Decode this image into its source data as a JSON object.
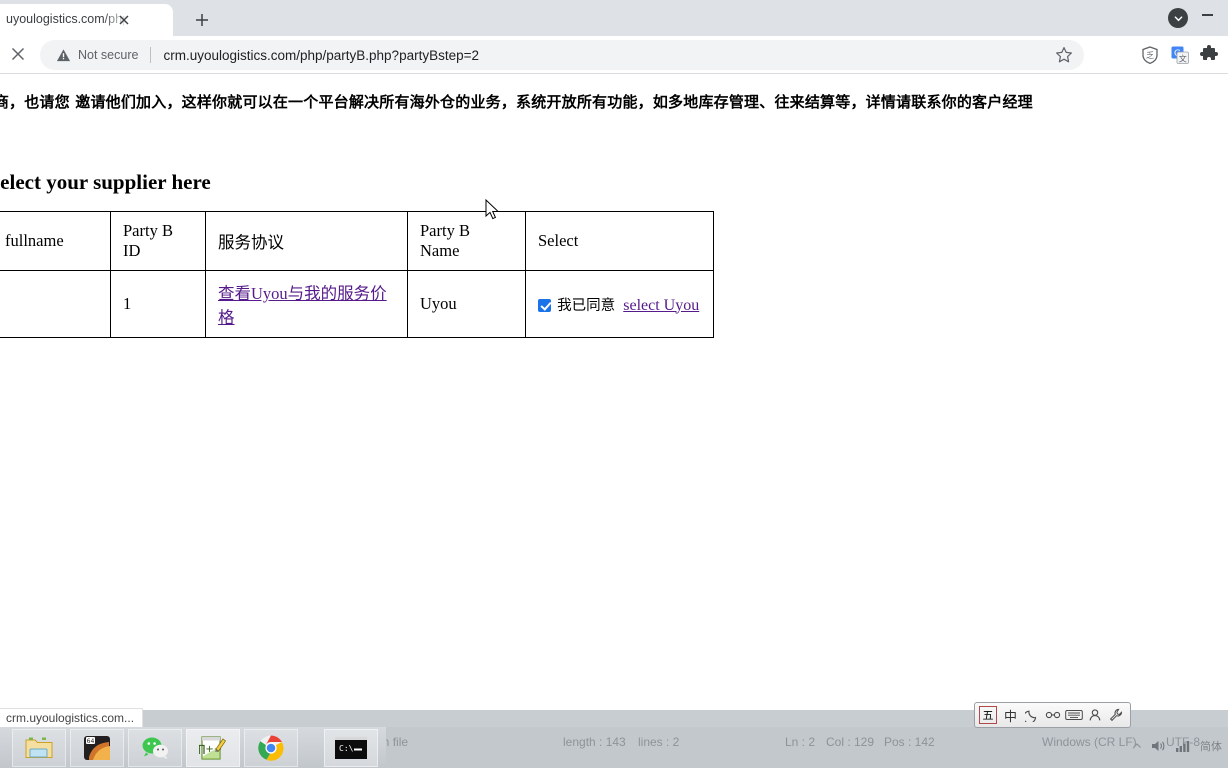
{
  "browser": {
    "tab": {
      "title": "uyoulogistics.com/php/party",
      "close_icon": "close-icon",
      "newtab_icon": "plus-icon"
    },
    "window": {
      "download_icon": "download-chevron-icon",
      "minimize_icon": "minimize-icon"
    },
    "toolbar": {
      "stop_icon": "stop-x-icon",
      "security_warning_icon": "warning-triangle-icon",
      "security_label": "Not secure",
      "url": "crm.uyoulogistics.com/php/partyB.php?partyBstep=2",
      "bookmark_icon": "star-icon",
      "shield_icon": "shield-icon",
      "translate_icon": "google-translate-icon",
      "extensions_icon": "puzzle-piece-icon"
    },
    "status_bubble": "crm.uyoulogistics.com..."
  },
  "page": {
    "banner": "而其他 服务供应商，也请您 邀请他们加入，这样你就可以在一个平台解决所有海外仓的业务，系统开放所有功能，如多地库存管理、往来结算等，详情请联系你的客户经理",
    "heading": "select your supplier here",
    "table": {
      "columns": [
        "fullname",
        "Party B ID",
        "服务协议",
        "Party B Name",
        "Select"
      ],
      "rows": [
        {
          "fullname": "",
          "party_b_id": "1",
          "agreement_link": "查看Uyou与我的服务价格",
          "party_b_name": "Uyou",
          "select": {
            "checkbox_checked": true,
            "agree_label": "我已同意",
            "select_link": "select Uyou"
          }
        }
      ]
    }
  },
  "background_app": {
    "language": "Python file",
    "length": "length : 143",
    "lines": "lines : 2",
    "ln": "Ln : 2",
    "col": "Col : 129",
    "pos": "Pos : 142",
    "eol": "Windows (CR LF)",
    "encoding": "UTF-8"
  },
  "ime": {
    "logo": "五",
    "items": [
      "中",
      "moon-icon",
      "punctuation-icon",
      "keyboard-icon",
      "user-icon",
      "wrench-icon"
    ],
    "tray_label": "简体"
  },
  "taskbar": {
    "items": [
      {
        "name": "file-explorer",
        "icon": "folder-icon"
      },
      {
        "name": "7zip",
        "icon": "archive-64-icon"
      },
      {
        "name": "wechat",
        "icon": "wechat-icon"
      },
      {
        "name": "notepadpp",
        "icon": "notepad-plus-plus-icon"
      },
      {
        "name": "chrome",
        "icon": "chrome-icon"
      },
      {
        "name": "command-prompt",
        "icon": "cmd-icon"
      }
    ]
  },
  "colors": {
    "visited_link": "#551a8b",
    "checkbox": "#1a73e8",
    "tabstrip": "#dee1e6",
    "omnibox": "#f1f3f4"
  }
}
